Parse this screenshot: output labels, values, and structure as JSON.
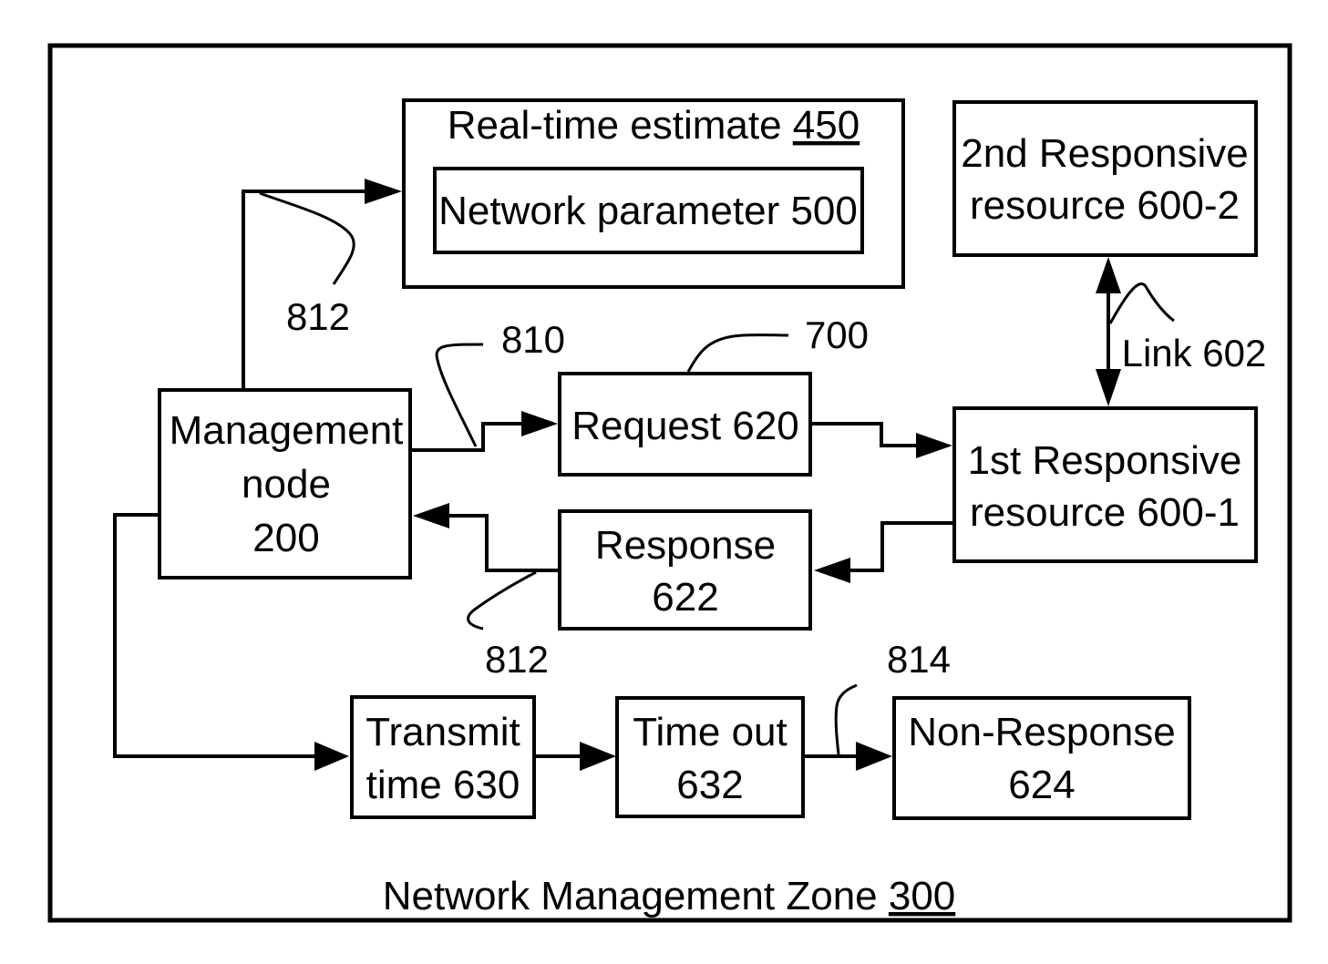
{
  "diagram": {
    "zone": {
      "label": "Network Management Zone ",
      "ref": "300"
    },
    "realtime_estimate": {
      "label": "Real-time estimate ",
      "ref": "450"
    },
    "network_parameter": {
      "label": "Network parameter 500"
    },
    "second_resource": {
      "line1": "2nd Responsive",
      "line2": "resource 600-2"
    },
    "first_resource": {
      "line1": "1st Responsive",
      "line2": "resource 600-1"
    },
    "link": {
      "label": "Link 602"
    },
    "management_node": {
      "line1": "Management",
      "line2": "node",
      "line3": "200"
    },
    "request": {
      "label": "Request 620"
    },
    "response": {
      "line1": "Response",
      "line2": "622"
    },
    "transmit_time": {
      "line1": "Transmit",
      "line2": "time 630"
    },
    "time_out": {
      "line1": "Time out",
      "line2": "632"
    },
    "non_response": {
      "line1": "Non-Response",
      "line2": "624"
    },
    "refs": {
      "ref_812_top": "812",
      "ref_810": "810",
      "ref_700": "700",
      "ref_812_bottom": "812",
      "ref_814": "814"
    },
    "colors": {
      "stroke": "#000000",
      "background": "#ffffff"
    }
  }
}
